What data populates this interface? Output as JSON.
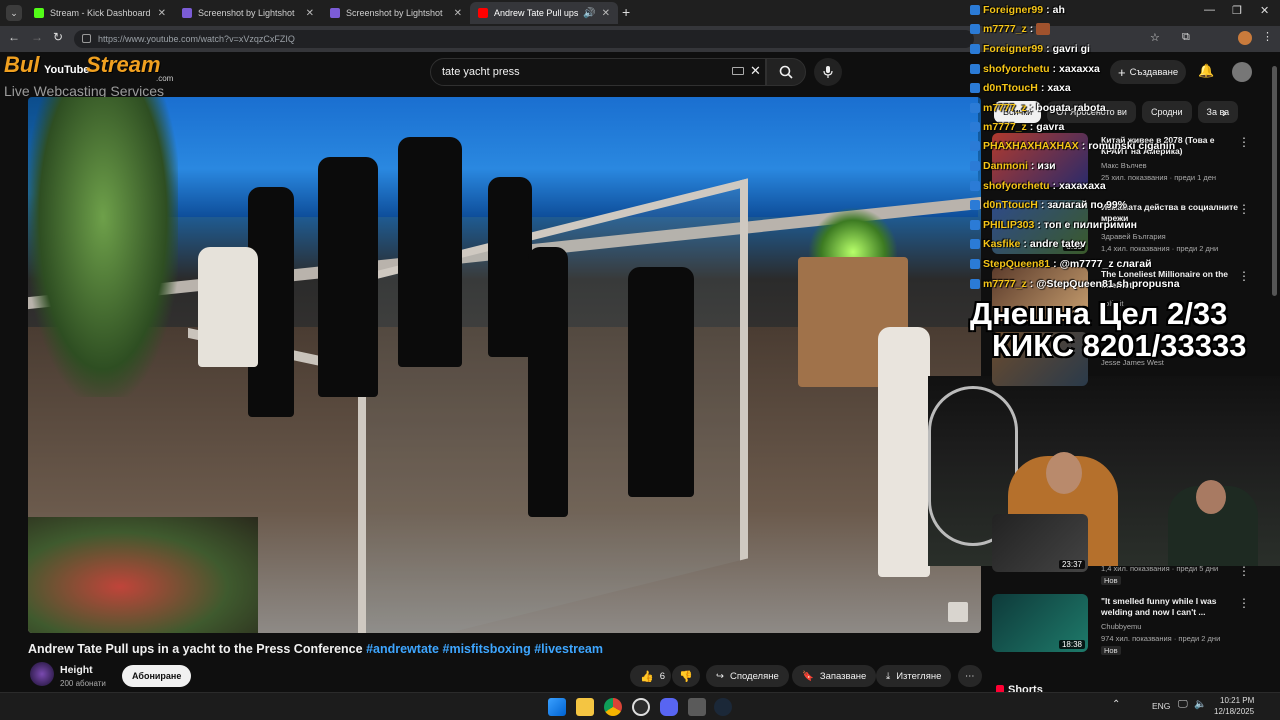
{
  "browser": {
    "tabs": [
      {
        "label": "Stream - Kick Dashboard",
        "color": "#53fc18"
      },
      {
        "label": "Screenshot by Lightshot",
        "color": "#7b5cd6"
      },
      {
        "label": "Screenshot by Lightshot",
        "color": "#7b5cd6"
      },
      {
        "label": "Andrew Tate Pull ups in a yac",
        "color": "#ff0000"
      }
    ],
    "url": "https://www.youtube.com/watch?v=xVzqzCxFZIQ"
  },
  "overlay_logo": {
    "line1": "Bul",
    "line2": "Stream",
    "line3": ".com",
    "tagline": "Live Webcasting Services",
    "yt": "YouTube"
  },
  "youtube": {
    "search_value": "tate yacht press",
    "create_label": "Създаване",
    "video_title": "Andrew Tate Pull ups in a yacht to the Press Conference",
    "hashtags": [
      "#andrewtate",
      "#misfitsboxing",
      "#livestream"
    ],
    "channel": {
      "name": "Height",
      "subs": "200 абонати",
      "subscribe_label": "Абониране"
    },
    "actions": {
      "likes": "6",
      "share": "Споделяне",
      "save": "Запазване",
      "download": "Изтегляне"
    },
    "chips": [
      "Всички",
      "От Ярoсеното ви",
      "Сродни",
      "За ва"
    ],
    "recommendations": [
      {
        "title": "Китай живее в 2078 (Това е КРАЙТ на Америка)",
        "channel": "Макс Вълчев",
        "meta": "25 хил. показвания · преди 1 ден",
        "color": "#b03a2e"
      },
      {
        "title": "Измамата действа в социалните мрежи",
        "channel": "Здравей България",
        "meta": "1,4 хил. показвания · преди 2 дни",
        "color": "#2e4a8a"
      },
      {
        "title": "The Loneliest Millionaire on the Internet",
        "channel": "golferit",
        "meta": "",
        "color": "#5b3b2b"
      },
      {
        "title": "",
        "channel": "Jesse James West",
        "meta": "",
        "color": "#6a4b2e"
      }
    ],
    "lower_recs": [
      {
        "duration": "23:37",
        "meta": "1,4 хил. показвания · преди 5 дни",
        "badge": "Нов"
      },
      {
        "title": "\"It smelled funny while I was welding and now I can't ...",
        "channel": "Chubbyemu",
        "meta": "974 хил. показвания · преди 2 дни",
        "badge": "Нов",
        "duration": "18:38"
      }
    ],
    "shorts_label": "Shorts"
  },
  "chat": [
    {
      "user": "Foreigner99",
      "msg": "ah"
    },
    {
      "user": "m7777_z",
      "msg": ""
    },
    {
      "user": "Foreigner99",
      "msg": "gavri gi"
    },
    {
      "user": "shofyorchetu",
      "msg": "хахахха"
    },
    {
      "user": "d0nTtoucH",
      "msg": "хаха"
    },
    {
      "user": "m7777_z",
      "msg": "bogata rabota"
    },
    {
      "user": "m7777_z",
      "msg": "gavra"
    },
    {
      "user": "PHAXHAXHAXHAX",
      "msg": "romunski ciganin"
    },
    {
      "user": "Danmoni",
      "msg": "изи"
    },
    {
      "user": "shofyorchetu",
      "msg": "хахахаха"
    },
    {
      "user": "d0nTtoucH",
      "msg": "залагай по 99%"
    },
    {
      "user": "PHILIP303",
      "msg": "топ е пилигримин"
    },
    {
      "user": "Kasfike",
      "msg": "andre tatev"
    },
    {
      "user": "StepQueen81",
      "msg": "@m7777_z слагай"
    },
    {
      "user": "m7777_z",
      "msg": "@StepQueen81 sh propusna"
    }
  ],
  "goals": {
    "line1": "Днешна Цел 2/33",
    "line2": "КИКС 8201/33333"
  },
  "taskbar": {
    "lang": "ENG",
    "time": "10:21 PM",
    "date": "12/18/2025"
  },
  "icons": [
    "chevron-down-icon",
    "back-icon",
    "forward-icon",
    "reload-icon",
    "search-icon",
    "mic-icon",
    "bell-icon",
    "like-icon",
    "dislike-icon",
    "share-icon",
    "save-icon",
    "download-icon",
    "more-icon",
    "windows-icon",
    "chrome-icon",
    "discord-icon",
    "steam-icon"
  ]
}
